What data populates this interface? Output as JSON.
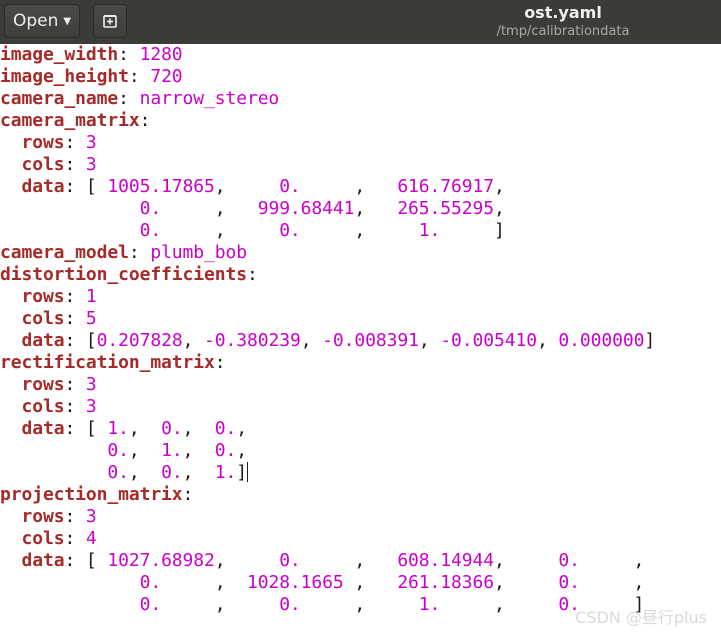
{
  "toolbar": {
    "open_label": "Open",
    "title": "ost.yaml",
    "subtitle": "/tmp/calibrationdata"
  },
  "lines": [
    [
      [
        "k",
        "image_width"
      ],
      [
        "p",
        ": "
      ],
      [
        "v",
        "1280"
      ]
    ],
    [
      [
        "k",
        "image_height"
      ],
      [
        "p",
        ": "
      ],
      [
        "v",
        "720"
      ]
    ],
    [
      [
        "k",
        "camera_name"
      ],
      [
        "p",
        ": "
      ],
      [
        "v",
        "narrow_stereo"
      ]
    ],
    [
      [
        "k",
        "camera_matrix"
      ],
      [
        "p",
        ":"
      ]
    ],
    [
      [
        "p",
        "  "
      ],
      [
        "k",
        "rows"
      ],
      [
        "p",
        ": "
      ],
      [
        "v",
        "3"
      ]
    ],
    [
      [
        "p",
        "  "
      ],
      [
        "k",
        "cols"
      ],
      [
        "p",
        ": "
      ],
      [
        "v",
        "3"
      ]
    ],
    [
      [
        "p",
        "  "
      ],
      [
        "k",
        "data"
      ],
      [
        "p",
        ": [ "
      ],
      [
        "v",
        "1005.17865"
      ],
      [
        "p",
        ",     "
      ],
      [
        "v",
        "0."
      ],
      [
        "p",
        "     ,   "
      ],
      [
        "v",
        "616.76917"
      ],
      [
        "p",
        ","
      ]
    ],
    [
      [
        "p",
        "             "
      ],
      [
        "v",
        "0."
      ],
      [
        "p",
        "     ,   "
      ],
      [
        "v",
        "999.68441"
      ],
      [
        "p",
        ",   "
      ],
      [
        "v",
        "265.55295"
      ],
      [
        "p",
        ","
      ]
    ],
    [
      [
        "p",
        "             "
      ],
      [
        "v",
        "0."
      ],
      [
        "p",
        "     ,     "
      ],
      [
        "v",
        "0."
      ],
      [
        "p",
        "     ,     "
      ],
      [
        "v",
        "1."
      ],
      [
        "p",
        "     ]"
      ]
    ],
    [
      [
        "k",
        "camera_model"
      ],
      [
        "p",
        ": "
      ],
      [
        "v",
        "plumb_bob"
      ]
    ],
    [
      [
        "k",
        "distortion_coefficients"
      ],
      [
        "p",
        ":"
      ]
    ],
    [
      [
        "p",
        "  "
      ],
      [
        "k",
        "rows"
      ],
      [
        "p",
        ": "
      ],
      [
        "v",
        "1"
      ]
    ],
    [
      [
        "p",
        "  "
      ],
      [
        "k",
        "cols"
      ],
      [
        "p",
        ": "
      ],
      [
        "v",
        "5"
      ]
    ],
    [
      [
        "p",
        "  "
      ],
      [
        "k",
        "data"
      ],
      [
        "p",
        ": ["
      ],
      [
        "v",
        "0.207828"
      ],
      [
        "p",
        ", "
      ],
      [
        "v",
        "-0.380239"
      ],
      [
        "p",
        ", "
      ],
      [
        "v",
        "-0.008391"
      ],
      [
        "p",
        ", "
      ],
      [
        "v",
        "-0.005410"
      ],
      [
        "p",
        ", "
      ],
      [
        "v",
        "0.000000"
      ],
      [
        "p",
        "]"
      ]
    ],
    [
      [
        "k",
        "rectification_matrix"
      ],
      [
        "p",
        ":"
      ]
    ],
    [
      [
        "p",
        "  "
      ],
      [
        "k",
        "rows"
      ],
      [
        "p",
        ": "
      ],
      [
        "v",
        "3"
      ]
    ],
    [
      [
        "p",
        "  "
      ],
      [
        "k",
        "cols"
      ],
      [
        "p",
        ": "
      ],
      [
        "v",
        "3"
      ]
    ],
    [
      [
        "p",
        "  "
      ],
      [
        "k",
        "data"
      ],
      [
        "p",
        ": [ "
      ],
      [
        "v",
        "1."
      ],
      [
        "p",
        ",  "
      ],
      [
        "v",
        "0."
      ],
      [
        "p",
        ",  "
      ],
      [
        "v",
        "0."
      ],
      [
        "p",
        ","
      ]
    ],
    [
      [
        "p",
        "          "
      ],
      [
        "v",
        "0."
      ],
      [
        "p",
        ",  "
      ],
      [
        "v",
        "1."
      ],
      [
        "p",
        ",  "
      ],
      [
        "v",
        "0."
      ],
      [
        "p",
        ","
      ]
    ],
    [
      [
        "p",
        "          "
      ],
      [
        "v",
        "0."
      ],
      [
        "p",
        ",  "
      ],
      [
        "v",
        "0."
      ],
      [
        "p",
        ",  "
      ],
      [
        "v",
        "1."
      ],
      [
        "p",
        "]"
      ],
      [
        "c",
        ""
      ]
    ],
    [
      [
        "k",
        "projection_matrix"
      ],
      [
        "p",
        ":"
      ]
    ],
    [
      [
        "p",
        "  "
      ],
      [
        "k",
        "rows"
      ],
      [
        "p",
        ": "
      ],
      [
        "v",
        "3"
      ]
    ],
    [
      [
        "p",
        "  "
      ],
      [
        "k",
        "cols"
      ],
      [
        "p",
        ": "
      ],
      [
        "v",
        "4"
      ]
    ],
    [
      [
        "p",
        "  "
      ],
      [
        "k",
        "data"
      ],
      [
        "p",
        ": [ "
      ],
      [
        "v",
        "1027.68982"
      ],
      [
        "p",
        ",     "
      ],
      [
        "v",
        "0."
      ],
      [
        "p",
        "     ,   "
      ],
      [
        "v",
        "608.14944"
      ],
      [
        "p",
        ",     "
      ],
      [
        "v",
        "0."
      ],
      [
        "p",
        "     ,"
      ]
    ],
    [
      [
        "p",
        "             "
      ],
      [
        "v",
        "0."
      ],
      [
        "p",
        "     ,  "
      ],
      [
        "v",
        "1028.1665"
      ],
      [
        "p",
        " ,   "
      ],
      [
        "v",
        "261.18366"
      ],
      [
        "p",
        ",     "
      ],
      [
        "v",
        "0."
      ],
      [
        "p",
        "     ,"
      ]
    ],
    [
      [
        "p",
        "             "
      ],
      [
        "v",
        "0."
      ],
      [
        "p",
        "     ,     "
      ],
      [
        "v",
        "0."
      ],
      [
        "p",
        "     ,     "
      ],
      [
        "v",
        "1."
      ],
      [
        "p",
        "     ,     "
      ],
      [
        "v",
        "0."
      ],
      [
        "p",
        "     ]"
      ]
    ]
  ],
  "watermark": "CSDN @昼行plus"
}
